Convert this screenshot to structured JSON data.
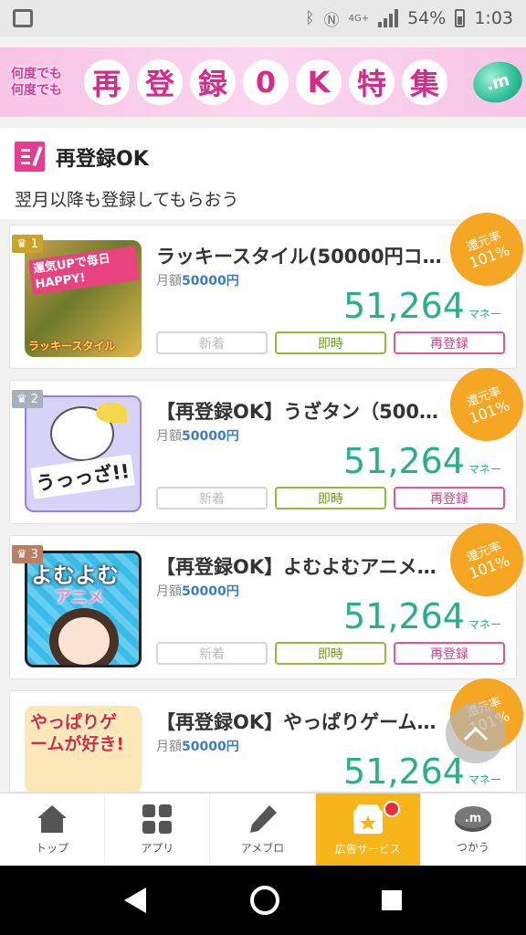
{
  "status": {
    "network": "4G+",
    "battery": "54%",
    "time": "1:03"
  },
  "banner": {
    "sub1": "何度でも",
    "sub2": "何度でも",
    "chars": [
      "再",
      "登",
      "録",
      "0",
      "K",
      "特",
      "集"
    ],
    "coin": ".m"
  },
  "section": {
    "title": "再登録OK",
    "description": "翌月以降も登録してもらおう"
  },
  "cards": [
    {
      "rank": "1",
      "title": "ラッキースタイル(50000円コ…",
      "price_label": "月額",
      "price": "50000円",
      "amount": "51,264",
      "unit": "マネー",
      "rate_label": "還元率",
      "rate": "101%",
      "tags": [
        "新着",
        "即時",
        "再登録"
      ],
      "thumb_text": "運気UPで毎日HAPPY!",
      "thumb_caption": "ラッキースタイル"
    },
    {
      "rank": "2",
      "title": "【再登録OK】うざタン（500…",
      "price_label": "月額",
      "price": "50000円",
      "amount": "51,264",
      "unit": "マネー",
      "rate_label": "還元率",
      "rate": "101%",
      "tags": [
        "新着",
        "即時",
        "再登録"
      ],
      "thumb_text": "うっっざ!!"
    },
    {
      "rank": "3",
      "title": "【再登録OK】よむよむアニメ…",
      "price_label": "月額",
      "price": "50000円",
      "amount": "51,264",
      "unit": "マネー",
      "rate_label": "還元率",
      "rate": "101%",
      "tags": [
        "新着",
        "即時",
        "再登録"
      ],
      "thumb_text": "よむよむ",
      "thumb_caption": "アニメ"
    },
    {
      "rank": "",
      "title": "【再登録OK】やっぱりゲーム…",
      "price_label": "月額",
      "price": "50000円",
      "amount": "51,264",
      "unit": "マネー",
      "rate_label": "還元率",
      "rate": "101%",
      "tags": [],
      "thumb_text": "やっぱりゲームが好き!"
    }
  ],
  "nav": [
    {
      "label": "トップ",
      "icon": "home-icon"
    },
    {
      "label": "アプリ",
      "icon": "apps-grid-icon"
    },
    {
      "label": "アメブロ",
      "icon": "pen-icon"
    },
    {
      "label": "広告サービス",
      "icon": "ad-box-icon"
    },
    {
      "label": "つかう",
      "icon": "coin-icon"
    }
  ],
  "colors": {
    "accent_pink": "#e83c92",
    "money_green": "#28b08c",
    "badge_orange": "#f5a622",
    "nav_active": "#f8b51a"
  }
}
